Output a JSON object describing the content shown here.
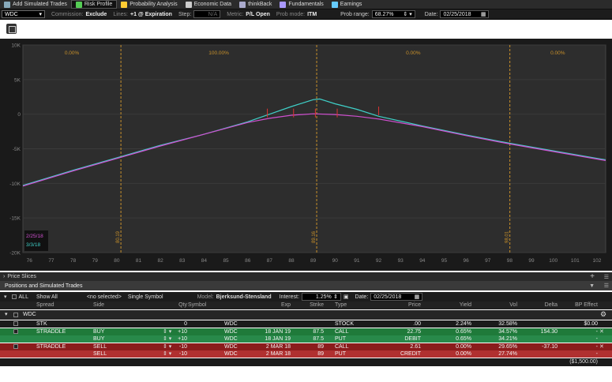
{
  "toolbar": {
    "tabs": [
      {
        "label": "Add Simulated Trades",
        "icon": "plus-icon",
        "active": false
      },
      {
        "label": "Risk Profile",
        "icon": "risk-profile-icon",
        "active": true
      },
      {
        "label": "Probability Analysis",
        "icon": "probability-icon",
        "active": false
      },
      {
        "label": "Economic Data",
        "icon": "economic-data-icon",
        "active": false
      },
      {
        "label": "thinkBack",
        "icon": "thinkback-icon",
        "active": false
      },
      {
        "label": "Fundamentals",
        "icon": "fundamentals-icon",
        "active": false
      },
      {
        "label": "Earnings",
        "icon": "earnings-icon",
        "active": false
      }
    ]
  },
  "options": {
    "symbol": "WDC",
    "commission_label": "Commission:",
    "commission": "Exclude",
    "lines_label": "Lines:",
    "lines": "+1 @ Expiration",
    "step_label": "Step:",
    "step": "N/A",
    "metric_label": "Metric:",
    "metric": "P/L Open",
    "prob_mode_label": "Prob mode:",
    "prob_mode": "ITM",
    "prob_range_label": "Prob range:",
    "prob_range": "68.27%",
    "date_label": "Date:",
    "date": "02/25/2018"
  },
  "chart_data": {
    "type": "line",
    "y_ticks": [
      "10K",
      "5K",
      "0",
      "-5K",
      "-10K",
      "-15K",
      "-20K"
    ],
    "ylim": [
      -20000,
      10000
    ],
    "x_ticks": [
      "76",
      "77",
      "78",
      "79",
      "80",
      "81",
      "82",
      "83",
      "84",
      "85",
      "86",
      "87",
      "88",
      "89",
      "90",
      "91",
      "92",
      "93",
      "94",
      "95",
      "96",
      "97",
      "98",
      "99",
      "100",
      "101",
      "102"
    ],
    "xlim": [
      75.7,
      102.4
    ],
    "prob_labels": [
      "0.00%",
      "100.00%",
      "0.00%",
      "0.00%"
    ],
    "vlines": [
      {
        "x": 80.19,
        "label": "80.19"
      },
      {
        "x": 89.16,
        "label": "89.16"
      },
      {
        "x": 98.01,
        "label": "98.01"
      }
    ],
    "series": [
      {
        "name": "3/3/18",
        "color": "#3fd0c8",
        "points": [
          [
            75.7,
            -10300
          ],
          [
            78,
            -8100
          ],
          [
            80,
            -6300
          ],
          [
            82,
            -4500
          ],
          [
            84,
            -2900
          ],
          [
            86,
            -1100
          ],
          [
            87,
            0
          ],
          [
            88,
            1100
          ],
          [
            89,
            2100
          ],
          [
            89.3,
            2200
          ],
          [
            90,
            1500
          ],
          [
            91,
            700
          ],
          [
            92,
            -300
          ],
          [
            94,
            -1700
          ],
          [
            96,
            -3000
          ],
          [
            98,
            -4200
          ],
          [
            100,
            -5300
          ],
          [
            102.4,
            -6600
          ]
        ]
      },
      {
        "name": "2/25/18",
        "color": "#d050d0",
        "points": [
          [
            75.7,
            -10400
          ],
          [
            78,
            -8200
          ],
          [
            80,
            -6400
          ],
          [
            82,
            -4600
          ],
          [
            84,
            -2900
          ],
          [
            86,
            -1200
          ],
          [
            87,
            -600
          ],
          [
            88,
            -150
          ],
          [
            89,
            50
          ],
          [
            90,
            -50
          ],
          [
            91,
            -300
          ],
          [
            92,
            -700
          ],
          [
            94,
            -1800
          ],
          [
            96,
            -3100
          ],
          [
            98,
            -4300
          ],
          [
            100,
            -5400
          ],
          [
            102.4,
            -6700
          ]
        ]
      }
    ]
  },
  "price_slices": {
    "label": "Price Slices"
  },
  "positions": {
    "title": "Positions and Simulated Trades",
    "all_label": "ALL",
    "show_all": "Show All",
    "selected": "<no selected>",
    "symbol_mode": "Single Symbol",
    "model_label": "Model:",
    "model": "Bjerksund-Stensland",
    "interest_label": "Interest:",
    "interest": "1.25%",
    "date_label": "Date:",
    "date": "02/25/2018"
  },
  "columns": [
    "Spread",
    "Side",
    "Qty",
    "Symbol",
    "Exp",
    "Strike",
    "Type",
    "Price",
    "Yield",
    "Vol",
    "Delta",
    "BP Effect"
  ],
  "group": {
    "name": "WDC"
  },
  "rows": [
    {
      "spread": "STK",
      "side": "",
      "qty": "0",
      "symbol": "WDC",
      "exp": "",
      "strike": "",
      "type": "STOCK",
      "price": ".00",
      "yield": "2.24%",
      "vol": "32.58%",
      "delta": "",
      "bp": "$0.00",
      "style": "stock"
    },
    {
      "spread": "STRADDLE",
      "side": "BUY",
      "qty": "+10",
      "symbol": "WDC",
      "exp": "18 JAN 19",
      "strike": "87.5",
      "type": "CALL",
      "price": "22.75",
      "yield": "0.65%",
      "vol": "34.57%",
      "delta": "154.30",
      "bp": "-",
      "style": "buy"
    },
    {
      "spread": "",
      "side": "BUY",
      "qty": "+10",
      "symbol": "WDC",
      "exp": "18 JAN 19",
      "strike": "87.5",
      "type": "PUT",
      "price": "DEBIT",
      "yield": "0.65%",
      "vol": "34.21%",
      "delta": "",
      "bp": "-",
      "style": "buy2"
    },
    {
      "spread": "STRADDLE",
      "side": "SELL",
      "qty": "-10",
      "symbol": "WDC",
      "exp": "2 MAR 18",
      "strike": "89",
      "type": "CALL",
      "price": "2.61",
      "yield": "0.00%",
      "vol": "29.65%",
      "delta": "-37.10",
      "bp": "-",
      "style": "sell"
    },
    {
      "spread": "",
      "side": "SELL",
      "qty": "-10",
      "symbol": "WDC",
      "exp": "2 MAR 18",
      "strike": "89",
      "type": "PUT",
      "price": "CREDIT",
      "yield": "0.00%",
      "vol": "27.74%",
      "delta": "",
      "bp": "-",
      "style": "sell2"
    }
  ],
  "total": {
    "bp": "($1,500.00)"
  }
}
